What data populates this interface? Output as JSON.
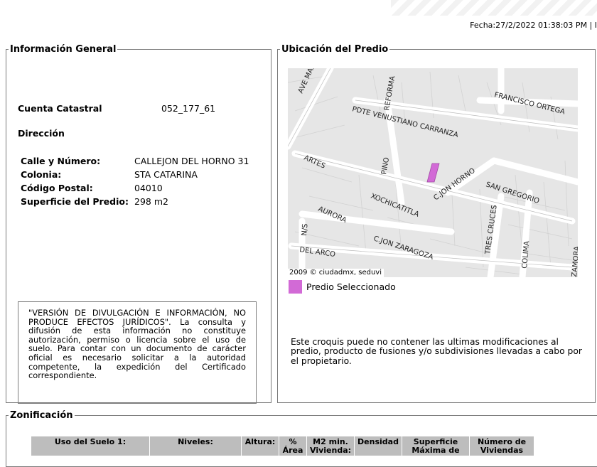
{
  "header": {
    "date": "Fecha:27/2/2022 01:38:03 PM | I"
  },
  "info": {
    "legend": "Información General",
    "cuenta_label": "Cuenta Catastral",
    "cuenta_value": "052_177_61",
    "direccion_label": "Dirección",
    "fields": [
      {
        "label": "Calle y Número:",
        "value": "CALLEJON DEL HORNO 31"
      },
      {
        "label": "Colonia:",
        "value": "STA CATARINA"
      },
      {
        "label": "Código Postal:",
        "value": "04010"
      },
      {
        "label": "Superficie del Predio:",
        "value": "298 m2"
      }
    ],
    "disclaimer": "\"VERSIÓN DE DIVULGACIÓN E INFORMACIÓN, NO PRODUCE EFECTOS JURÍDICOS\". La consulta y difusión de esta información no constituye autorización, permiso o licencia sobre el uso de suelo. Para contar con un documento de carácter oficial es necesario solicitar a la autoridad competente, la expedición del Certificado correspondiente."
  },
  "ubicacion": {
    "legend": "Ubicación del Predio",
    "copyright": "2009 © ciudadmx, seduvi",
    "legend_label": "Predio Seleccionado",
    "legend_color": "#d26ad6",
    "note": "Este croquis puede no contener las ultimas modificaciones al predio, producto de fusiones y/o subdivisiones llevadas a cabo por el propietario.",
    "streets": [
      "AVE MAR",
      "REFORMA",
      "FRANCISCO ORTEGA",
      "PDTE VENUSTIANO CARRANZA",
      "ARTES",
      "PINO",
      "C.JON HORNO",
      "SAN GREGORIO",
      "XOCHICATITLA",
      "AURORA",
      "N/S",
      "TRES CRUCES",
      "C.JON ZARAGOZA",
      "COLIMA",
      "DEL ARCO",
      "ZAMORA"
    ]
  },
  "zonificacion": {
    "legend": "Zonificación",
    "columns": [
      "Uso del Suelo 1:",
      "Niveles:",
      "Altura:",
      "% Área",
      "M2 min. Vivienda:",
      "Densidad",
      "Superficie Máxima de",
      "Número de Viviendas"
    ]
  }
}
